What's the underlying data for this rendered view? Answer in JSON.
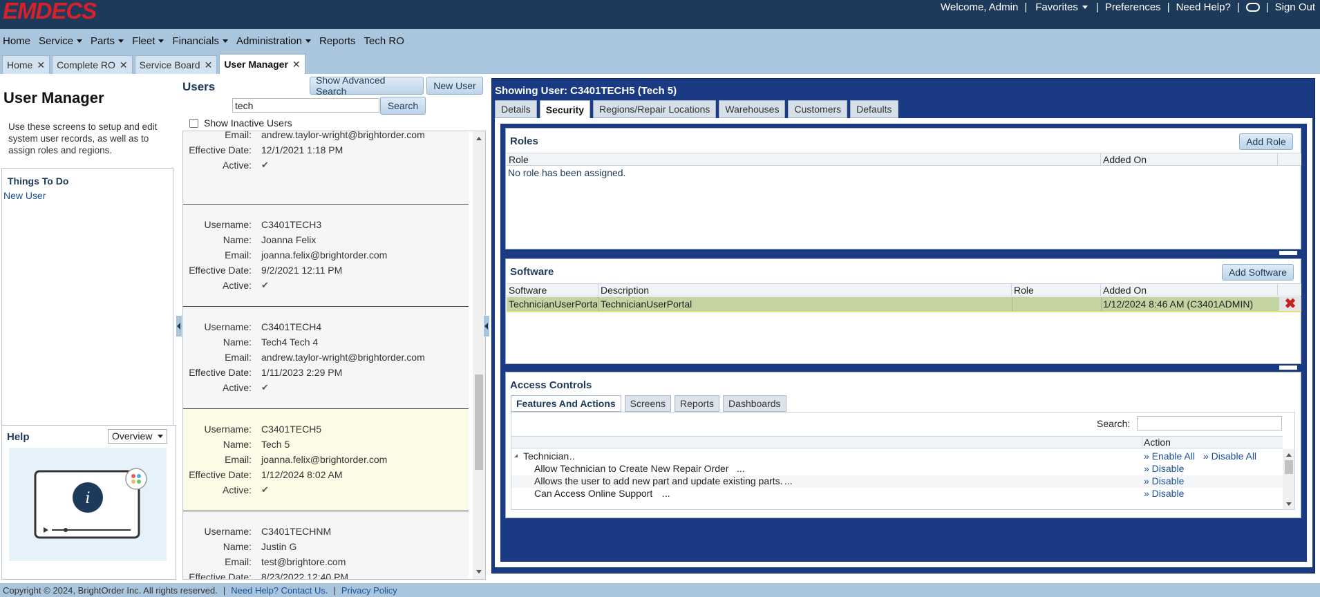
{
  "app": {
    "logo": "EMDECS"
  },
  "topbar": {
    "welcome": "Welcome, Admin",
    "favorites": "Favorites",
    "preferences": "Preferences",
    "need_help": "Need Help?",
    "sign_out": "Sign Out"
  },
  "nav": {
    "items": [
      {
        "label": "Home",
        "dropdown": false
      },
      {
        "label": "Service",
        "dropdown": true
      },
      {
        "label": "Parts",
        "dropdown": true
      },
      {
        "label": "Fleet",
        "dropdown": true
      },
      {
        "label": "Financials",
        "dropdown": true
      },
      {
        "label": "Administration",
        "dropdown": true
      },
      {
        "label": "Reports",
        "dropdown": false
      },
      {
        "label": "Tech RO",
        "dropdown": false
      }
    ]
  },
  "doc_tabs": [
    {
      "label": "Home",
      "active": false
    },
    {
      "label": "Complete RO",
      "active": false
    },
    {
      "label": "Service Board",
      "active": false
    },
    {
      "label": "User Manager",
      "active": true
    }
  ],
  "left": {
    "title": "User Manager",
    "description": "Use these screens to setup and edit system user records, as well as to assign roles and regions.",
    "todo_title": "Things To Do",
    "todo_new_user": "New User",
    "help_title": "Help",
    "help_select": "Overview"
  },
  "users": {
    "title": "Users",
    "advanced_search": "Show Advanced Search",
    "new_user": "New User",
    "search_value": "tech",
    "search_button": "Search",
    "show_inactive": "Show Inactive Users",
    "labels": {
      "username": "Username:",
      "name": "Name:",
      "email": "Email:",
      "effective": "Effective Date:",
      "active": "Active:"
    },
    "list": [
      {
        "username": "",
        "name": "",
        "email": "andrew.taylor-wright@brightorder.com",
        "effective": "12/1/2021 1:18 PM",
        "selected": false,
        "partial": true
      },
      {
        "username": "C3401TECH3",
        "name": "Joanna Felix",
        "email": "joanna.felix@brightorder.com",
        "effective": "9/2/2021 12:11 PM",
        "selected": false
      },
      {
        "username": "C3401TECH4",
        "name": "Tech4 Tech 4",
        "email": "andrew.taylor-wright@brightorder.com",
        "effective": "1/11/2023 2:29 PM",
        "selected": false
      },
      {
        "username": "C3401TECH5",
        "name": "Tech 5",
        "email": "joanna.felix@brightorder.com",
        "effective": "1/12/2024 8:02 AM",
        "selected": true
      },
      {
        "username": "C3401TECHNM",
        "name": "Justin G",
        "email": "test@brightore.com",
        "effective": "8/23/2022 12:40 PM",
        "selected": false
      }
    ]
  },
  "detail": {
    "title": "Showing User: C3401TECH5 (Tech 5)",
    "tabs": [
      {
        "label": "Details",
        "active": false
      },
      {
        "label": "Security",
        "active": true
      },
      {
        "label": "Regions/Repair Locations",
        "active": false
      },
      {
        "label": "Warehouses",
        "active": false
      },
      {
        "label": "Customers",
        "active": false
      },
      {
        "label": "Defaults",
        "active": false
      }
    ],
    "roles": {
      "title": "Roles",
      "add_button": "Add Role",
      "columns": [
        "Role",
        "Added On"
      ],
      "empty_text": "No role has been assigned."
    },
    "software": {
      "title": "Software",
      "add_button": "Add Software",
      "columns": [
        "Software",
        "Description",
        "Role",
        "Added On"
      ],
      "rows": [
        {
          "software": "TechnicianUserPortal",
          "description": "TechnicianUserPortal",
          "role": "",
          "added_on": "1/12/2024 8:46 AM (C3401ADMIN)"
        }
      ]
    },
    "access": {
      "title": "Access Controls",
      "tabs": [
        {
          "label": "Features And Actions",
          "active": true
        },
        {
          "label": "Screens",
          "active": false
        },
        {
          "label": "Reports",
          "active": false
        },
        {
          "label": "Dashboards",
          "active": false
        }
      ],
      "search_label": "Search:",
      "search_value": "",
      "action_header": "Action",
      "group": {
        "name": "Technician",
        "more": "...",
        "enable_all": "» Enable All",
        "disable_all": "» Disable All"
      },
      "items": [
        {
          "name": "Allow Technician to Create New Repair Order",
          "more": "...",
          "action": "» Disable"
        },
        {
          "name": "Allows the user to add new part and update existing parts.",
          "more": "...",
          "action": "» Disable"
        },
        {
          "name": "Can Access Online Support",
          "more": "...",
          "action": "» Disable"
        }
      ]
    }
  },
  "footer": {
    "copyright": "Copyright © 2024, BrightOrder Inc. All rights reserved.",
    "contact": "Need Help? Contact Us.",
    "privacy": "Privacy Policy"
  },
  "colors": {
    "topbar": "#1d3a5a",
    "nav": "#aac6de",
    "logo": "#d9202a",
    "detail_panel": "#1a3a84",
    "software_row": "#c2d5a0",
    "selected_user": "#fbfbe6"
  }
}
